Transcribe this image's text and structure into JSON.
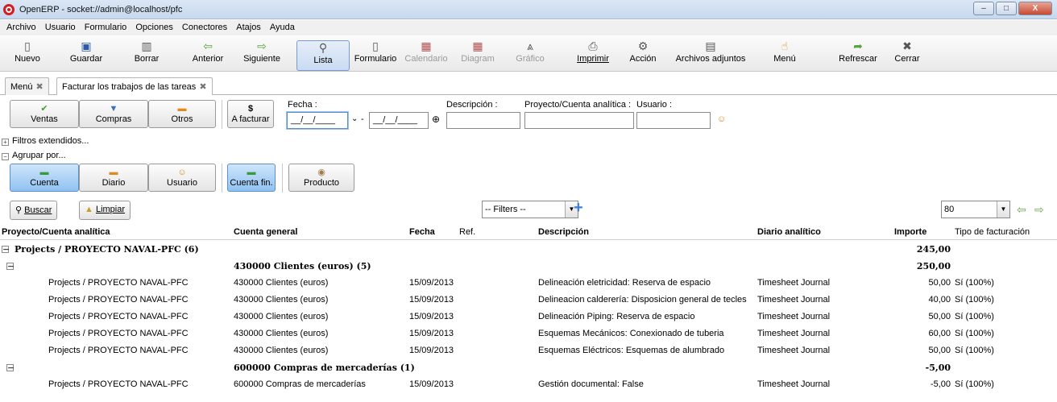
{
  "window": {
    "title": "OpenERP - socket://admin@localhost/pfc",
    "min": "–",
    "max": "□",
    "close": "X"
  },
  "menubar": [
    "Archivo",
    "Usuario",
    "Formulario",
    "Opciones",
    "Conectores",
    "Atajos",
    "Ayuda"
  ],
  "toolbar": {
    "nuevo": "Nuevo",
    "guardar": "Guardar",
    "borrar": "Borrar",
    "anterior": "Anterior",
    "siguiente": "Siguiente",
    "lista": "Lista",
    "formulario": "Formulario",
    "calendario": "Calendario",
    "diagram": "Diagram",
    "grafico": "Gráfico",
    "imprimir": "Imprimir",
    "accion": "Acción",
    "adjuntos": "Archivos adjuntos",
    "menu": "Menú",
    "refrescar": "Refrescar",
    "cerrar": "Cerrar"
  },
  "tabs": [
    "Menú",
    "Facturar los trabajos de las tareas"
  ],
  "filters": {
    "ventas": "Ventas",
    "compras": "Compras",
    "otros": "Otros",
    "a_facturar": "A facturar",
    "a_facturar_icon": "$",
    "fecha_label": "Fecha :",
    "descripcion_label": "Descripción :",
    "proyecto_label": "Proyecto/Cuenta analítica :",
    "usuario_label": "Usuario :",
    "date_from": "__/__/____",
    "date_to": "__/__/____",
    "date_sep": "-",
    "extendidos": "Filtros extendidos...",
    "agrupar": "Agrupar por..."
  },
  "groupby": {
    "cuenta": "Cuenta",
    "diario": "Diario",
    "usuario": "Usuario",
    "cuenta_fin": "Cuenta fin.",
    "producto": "Producto"
  },
  "actions": {
    "buscar": "Buscar",
    "limpiar": "Limpiar",
    "filters_select": "-- Filters --",
    "limit": "80"
  },
  "columns": {
    "proyecto": "Proyecto/Cuenta analítica",
    "cuenta": "Cuenta general",
    "fecha": "Fecha",
    "ref": "Ref.",
    "descripcion": "Descripción",
    "diario": "Diario analítico",
    "importe": "Importe",
    "tipo": "Tipo de facturación"
  },
  "group1": {
    "label": "Projects / PROYECTO NAVAL-PFC (6)",
    "total": "245,00"
  },
  "sub1": {
    "label": "430000 Clientes (euros) (5)",
    "total": "250,00"
  },
  "sub2": {
    "label": "600000 Compras de mercaderías (1)",
    "total": "-5,00"
  },
  "rows": [
    {
      "proyecto": "Projects / PROYECTO NAVAL-PFC",
      "cuenta": "430000 Clientes (euros)",
      "fecha": "15/09/2013",
      "descripcion": "Delineación eletricidad: Reserva de espacio",
      "diario": "Timesheet Journal",
      "importe": "50,00",
      "tipo": "Sí (100%)"
    },
    {
      "proyecto": "Projects / PROYECTO NAVAL-PFC",
      "cuenta": "430000 Clientes (euros)",
      "fecha": "15/09/2013",
      "descripcion": "Delineacion calderería: Disposicion general de tecles",
      "diario": "Timesheet Journal",
      "importe": "40,00",
      "tipo": "Sí (100%)"
    },
    {
      "proyecto": "Projects / PROYECTO NAVAL-PFC",
      "cuenta": "430000 Clientes (euros)",
      "fecha": "15/09/2013",
      "descripcion": "Delineación Piping: Reserva de espacio",
      "diario": "Timesheet Journal",
      "importe": "50,00",
      "tipo": "Sí (100%)"
    },
    {
      "proyecto": "Projects / PROYECTO NAVAL-PFC",
      "cuenta": "430000 Clientes (euros)",
      "fecha": "15/09/2013",
      "descripcion": "Esquemas Mecánicos: Conexionado de tuberia",
      "diario": "Timesheet Journal",
      "importe": "60,00",
      "tipo": "Sí (100%)"
    },
    {
      "proyecto": "Projects / PROYECTO NAVAL-PFC",
      "cuenta": "430000 Clientes (euros)",
      "fecha": "15/09/2013",
      "descripcion": "Esquemas Eléctricos: Esquemas de alumbrado",
      "diario": "Timesheet Journal",
      "importe": "50,00",
      "tipo": "Sí (100%)"
    },
    {
      "proyecto": "Projects / PROYECTO NAVAL-PFC",
      "cuenta": "600000 Compras de mercaderías",
      "fecha": "15/09/2013",
      "descripcion": "Gestión documental: False",
      "diario": "Timesheet Journal",
      "importe": "-5,00",
      "tipo": "Sí (100%)"
    }
  ]
}
